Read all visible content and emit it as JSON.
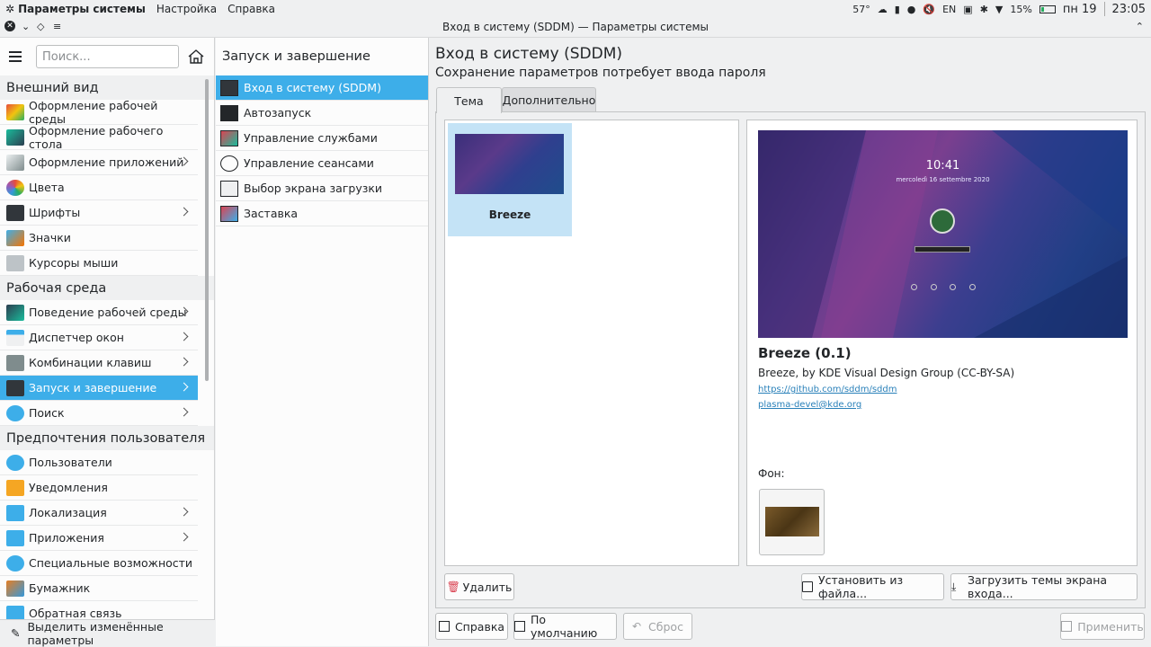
{
  "topbar": {
    "app_name": "Параметры системы",
    "menu": [
      "Настройка",
      "Справка"
    ],
    "temperature": "57°",
    "layout": "EN",
    "battery": "15%",
    "day": "пн 19",
    "time": "23:05"
  },
  "window": {
    "title": "Вход в систему (SDDM) — Параметры системы"
  },
  "sidebar": {
    "search_placeholder": "Поиск...",
    "categories": [
      {
        "title": "Внешний вид",
        "items": [
          {
            "label": "Оформление рабочей среды",
            "icon": "appearance-icon",
            "chevron": false
          },
          {
            "label": "Оформление рабочего стола",
            "icon": "desktop-theme-icon",
            "chevron": false
          },
          {
            "label": "Оформление приложений",
            "icon": "app-style-icon",
            "chevron": true
          },
          {
            "label": "Цвета",
            "icon": "colors-icon",
            "chevron": false
          },
          {
            "label": "Шрифты",
            "icon": "fonts-icon",
            "chevron": true
          },
          {
            "label": "Значки",
            "icon": "icons-icon",
            "chevron": false
          },
          {
            "label": "Курсоры мыши",
            "icon": "cursor-icon",
            "chevron": false
          }
        ]
      },
      {
        "title": "Рабочая среда",
        "items": [
          {
            "label": "Поведение рабочей среды",
            "icon": "workspace-behavior-icon",
            "chevron": true
          },
          {
            "label": "Диспетчер окон",
            "icon": "window-manager-icon",
            "chevron": true
          },
          {
            "label": "Комбинации клавиш",
            "icon": "keyboard-icon",
            "chevron": true
          },
          {
            "label": "Запуск и завершение",
            "icon": "startup-icon",
            "chevron": true,
            "selected": true
          },
          {
            "label": "Поиск",
            "icon": "search-icon",
            "chevron": true
          }
        ]
      },
      {
        "title": "Предпочтения пользователя",
        "items": [
          {
            "label": "Пользователи",
            "icon": "users-icon",
            "chevron": false
          },
          {
            "label": "Уведомления",
            "icon": "bell-icon",
            "chevron": false
          },
          {
            "label": "Локализация",
            "icon": "locale-icon",
            "chevron": true
          },
          {
            "label": "Приложения",
            "icon": "applications-icon",
            "chevron": true
          },
          {
            "label": "Специальные возможности",
            "icon": "accessibility-icon",
            "chevron": false
          },
          {
            "label": "Бумажник",
            "icon": "wallet-icon",
            "chevron": false
          },
          {
            "label": "Обратная связь",
            "icon": "feedback-icon",
            "chevron": false
          }
        ]
      }
    ],
    "highlight_label": "Выделить изменённые параметры"
  },
  "subnav": {
    "title": "Запуск и завершение",
    "items": [
      {
        "label": "Вход в систему (SDDM)",
        "selected": true
      },
      {
        "label": "Автозапуск"
      },
      {
        "label": "Управление службами"
      },
      {
        "label": "Управление сеансами"
      },
      {
        "label": "Выбор экрана загрузки"
      },
      {
        "label": "Заставка"
      }
    ]
  },
  "main": {
    "title": "Вход в систему (SDDM)",
    "subtitle": "Сохранение параметров потребует ввода пароля",
    "tabs": [
      "Тема",
      "Дополнительно"
    ],
    "theme_name": "Breeze",
    "preview_clock": "10:41",
    "preview_date": "mercoledì 16 settembre 2020",
    "detail_title": "Breeze (0.1)",
    "detail_author": "Breeze, by KDE Visual Design Group (CC-BY-SA)",
    "link_website": "https://github.com/sddm/sddm",
    "link_email": "plasma-devel@kde.org",
    "background_label": "Фон:",
    "buttons": {
      "delete": "Удалить",
      "install_file": "Установить из файла...",
      "download": "Загрузить темы экрана входа..."
    }
  },
  "footer": {
    "help": "Справка",
    "defaults": "По умолчанию",
    "reset": "Сброс",
    "apply": "Применить"
  },
  "colors": {
    "accent": "#3daee9",
    "window_bg": "#eff0f1",
    "link": "#2980b9"
  }
}
